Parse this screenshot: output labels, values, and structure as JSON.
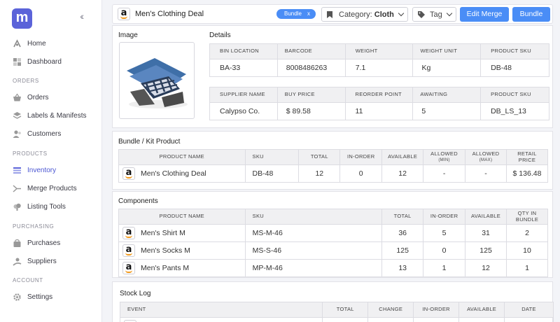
{
  "sidebar": {
    "logo": "m",
    "items": [
      {
        "label": "Home"
      },
      {
        "label": "Dashboard"
      },
      {
        "label": "Orders"
      },
      {
        "label": "Labels & Manifests"
      },
      {
        "label": "Customers"
      },
      {
        "label": "Inventory"
      },
      {
        "label": "Merge Products"
      },
      {
        "label": "Listing Tools"
      },
      {
        "label": "Purchases"
      },
      {
        "label": "Suppliers"
      },
      {
        "label": "Settings"
      }
    ],
    "sections": [
      "ORDERS",
      "PRODUCTS",
      "PURCHASING",
      "ACCOUNT"
    ],
    "active_color": "#4b56d2"
  },
  "header": {
    "title": "Men's Clothing Deal",
    "badge": "Bundle",
    "badge_close": "x",
    "category_label": "Category:",
    "category_value": "Cloth",
    "tag_label": "Tag",
    "edit_merge": "Edit Merge",
    "bundle": "Bundle"
  },
  "image_section": {
    "label": "Image"
  },
  "details": {
    "label": "Details",
    "table1": {
      "headers": [
        "BIN LOCATION",
        "BARCODE",
        "WEIGHT",
        "WEIGHT UNIT",
        "PRODUCT SKU"
      ],
      "row": [
        "BA-33",
        "8008486263",
        "7.1",
        "Kg",
        "DB-48"
      ]
    },
    "table2": {
      "headers": [
        "SUPPLIER NAME",
        "BUY PRICE",
        "REORDER POINT",
        "AWAITING",
        "PRODUCT SKU"
      ],
      "row": [
        "Calypso Co.",
        "$ 89.58",
        "11",
        "5",
        "DB_LS_13"
      ]
    }
  },
  "bundle_kit": {
    "label": "Bundle / Kit Product",
    "headers": [
      "PRODUCT NAME",
      "SKU",
      "TOTAL",
      "IN-ORDER",
      "AVAILABLE",
      "ALLOWED",
      "(MIN)",
      "ALLOWED",
      "(MAX)",
      "RETAIL",
      "PRICE"
    ],
    "row": {
      "name": "Men's Clothing Deal",
      "sku": "DB-48",
      "total": "12",
      "in_order": "0",
      "available": "12",
      "min": "-",
      "max": "-",
      "price": "$ 136.48"
    }
  },
  "components": {
    "label": "Components",
    "headers": [
      "PRODUCT NAME",
      "SKU",
      "TOTAL",
      "IN-ORDER",
      "AVAILABLE",
      "QTY IN",
      "BUNDLE"
    ],
    "rows": [
      {
        "name": "Men's Shirt M",
        "sku": "MS-M-46",
        "total": "36",
        "in_order": "5",
        "available": "31",
        "qty": "2"
      },
      {
        "name": "Men's Socks M",
        "sku": "MS-S-46",
        "total": "125",
        "in_order": "0",
        "available": "125",
        "qty": "10"
      },
      {
        "name": "Men's Pants M",
        "sku": "MP-M-46",
        "total": "13",
        "in_order": "1",
        "available": "12",
        "qty": "1"
      }
    ]
  },
  "stock_log": {
    "label": "Stock Log",
    "headers": [
      "EVENT",
      "TOTAL",
      "CHANGE",
      "IN-ORDER",
      "AVAILABLE",
      "DATE"
    ]
  },
  "colors": {
    "primary": "#4a8df6",
    "brand": "#5b63d9",
    "amazon_orange": "#f29a1d"
  }
}
